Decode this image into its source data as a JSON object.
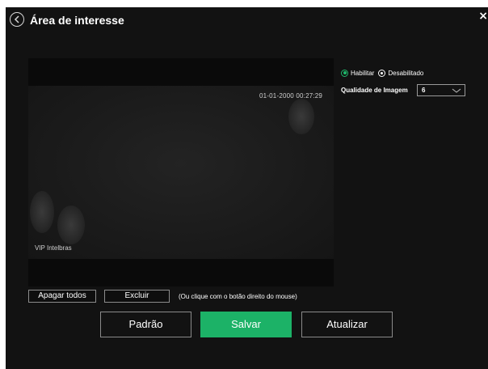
{
  "page": {
    "title": "Área de interesse"
  },
  "video": {
    "timestamp": "01-01-2000 00:27:29",
    "camera_name": "VIP Intelbras"
  },
  "settings": {
    "enable_label": "Habilitar",
    "disable_label": "Desabilitado",
    "enable_selected": true,
    "quality_label": "Qualidade de Imagem",
    "quality_value": "6"
  },
  "actions": {
    "clear_all": "Apagar todos",
    "delete": "Excluir",
    "hint": "(Ou clique com o botão direito do mouse)",
    "default": "Padrão",
    "save": "Salvar",
    "refresh": "Atualizar"
  },
  "colors": {
    "background": "#121212",
    "accent": "#1cb267"
  },
  "icons": {
    "back": "back-circle-arrow",
    "close": "close-x",
    "dropdown": "chevron-down"
  }
}
